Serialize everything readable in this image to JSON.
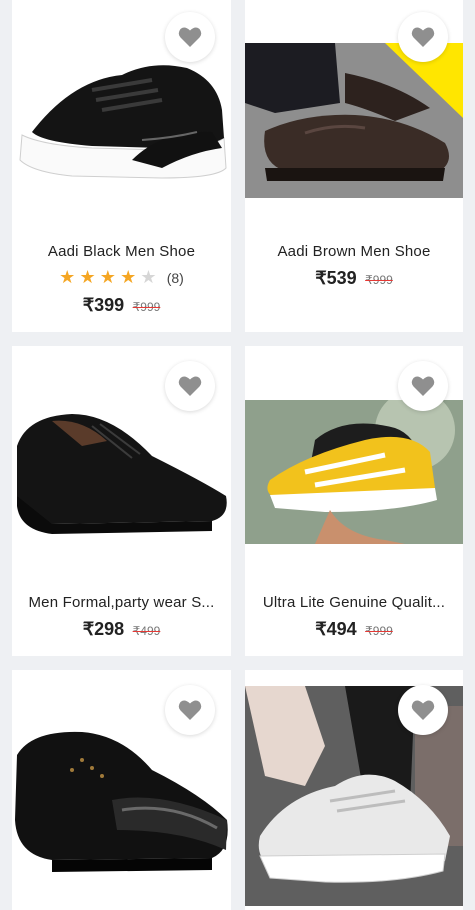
{
  "products": [
    {
      "title": "Aadi Black Men Shoe",
      "rating_stars": 4,
      "rating_count": "(8)",
      "price": "₹399",
      "mrp": "₹999"
    },
    {
      "title": "Aadi Brown Men Shoe",
      "price": "₹539",
      "mrp": "₹999"
    },
    {
      "title": "Men Formal,party wear S...",
      "price": "₹298",
      "mrp": "₹499"
    },
    {
      "title": "Ultra Lite Genuine Qualit...",
      "price": "₹494",
      "mrp": "₹999"
    },
    {
      "title": "",
      "price": "",
      "mrp": ""
    },
    {
      "title": "",
      "price": "",
      "mrp": ""
    }
  ],
  "colors": {
    "accent_star": "#f5a623",
    "strike": "#e53935",
    "promo_ribbon": "#ffe600"
  },
  "icons": {
    "wishlist": "heart-icon"
  }
}
